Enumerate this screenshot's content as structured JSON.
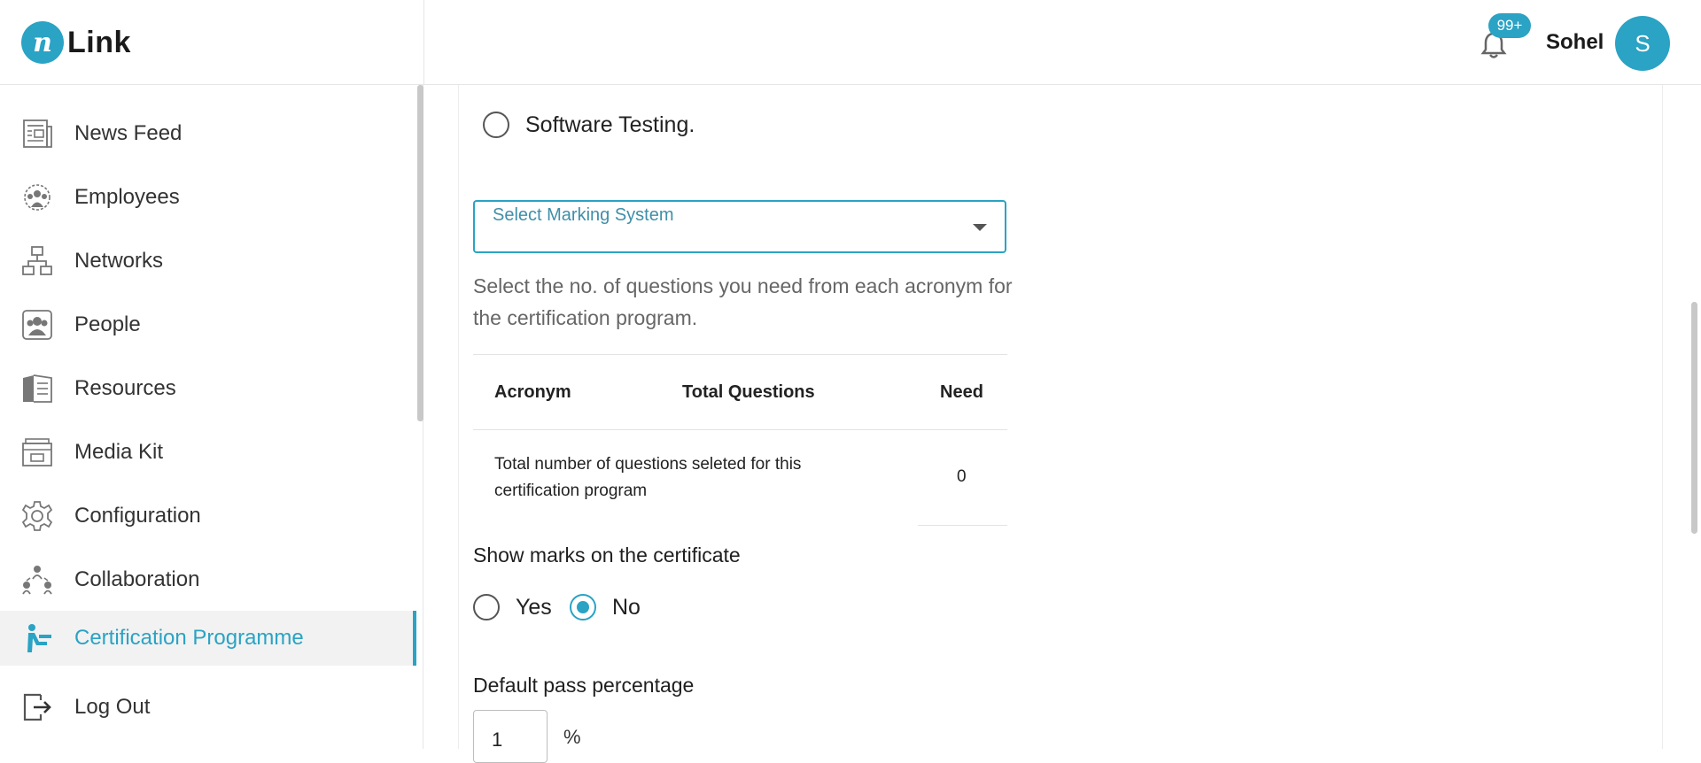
{
  "header": {
    "logo_mark": "n",
    "logo_text": "Link",
    "notifications_badge": "99+",
    "user_name": "Sohel",
    "avatar_initial": "S"
  },
  "sidebar": {
    "items": [
      {
        "label": "News Feed",
        "icon": "newspaper-icon",
        "active": false
      },
      {
        "label": "Employees",
        "icon": "employees-icon",
        "active": false
      },
      {
        "label": "Networks",
        "icon": "network-icon",
        "active": false
      },
      {
        "label": "People",
        "icon": "people-icon",
        "active": false
      },
      {
        "label": "Resources",
        "icon": "book-icon",
        "active": false
      },
      {
        "label": "Media Kit",
        "icon": "media-kit-icon",
        "active": false
      },
      {
        "label": "Configuration",
        "icon": "gear-icon",
        "active": false
      },
      {
        "label": "Collaboration",
        "icon": "collaboration-icon",
        "active": false
      },
      {
        "label": "Certification Programme",
        "icon": "certification-icon",
        "active": true
      },
      {
        "label": "Log Out",
        "icon": "logout-icon",
        "active": false
      }
    ]
  },
  "main": {
    "option_label": "Software Testing.",
    "select_placeholder": "Select Marking System",
    "help_text": "Select the no. of questions you need from each acronym for the certification program.",
    "table": {
      "headers": [
        "Acronym",
        "Total Questions",
        "Need"
      ],
      "total_label": "Total number of questions seleted for this certification program",
      "total_value": "0"
    },
    "show_marks": {
      "label": "Show marks on the certificate",
      "yes": "Yes",
      "no": "No",
      "selected": "No"
    },
    "pass": {
      "label": "Default pass percentage",
      "value": "1",
      "unit": "%"
    }
  },
  "colors": {
    "accent": "#2aa3c4"
  }
}
